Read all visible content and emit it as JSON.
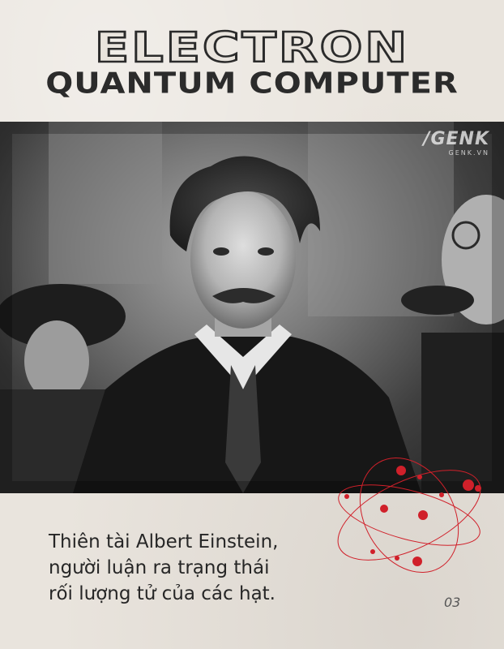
{
  "title": {
    "main": "ELECTRON",
    "subtitle": "QUANTUM COMPUTER"
  },
  "watermark": {
    "logo": "/GENK",
    "sub": "GENK.VN"
  },
  "caption": {
    "lines": [
      "Thiên tài Albert Einstein,",
      "người luận ra trạng thái",
      "rối lượng tử của các hạt."
    ]
  },
  "page_number": "03",
  "colors": {
    "background": "#e9e4dd",
    "title": "#2b2b2b",
    "accent": "#d0202a",
    "caption_text": "#262626"
  },
  "photo": {
    "style": "black-and-white",
    "icon": "portrait-photo"
  }
}
